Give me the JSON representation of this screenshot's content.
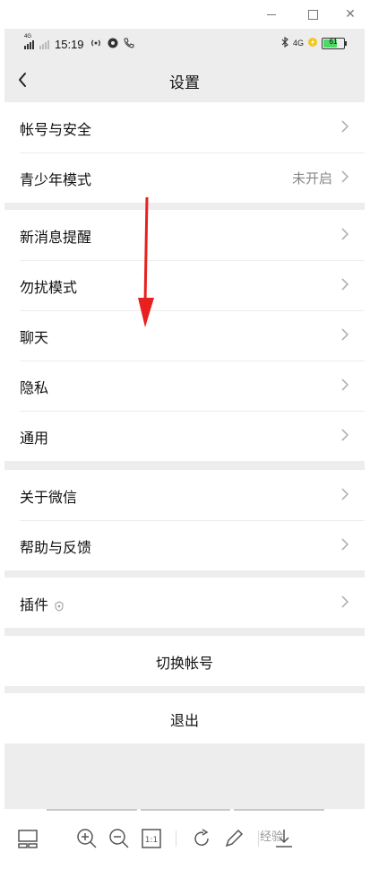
{
  "status": {
    "time": "15:19",
    "network_left": "4G",
    "network_right": "4G",
    "battery": "61"
  },
  "nav": {
    "title": "设置"
  },
  "groups": {
    "g1": [
      {
        "label": "帐号与安全",
        "value": ""
      },
      {
        "label": "青少年模式",
        "value": "未开启"
      }
    ],
    "g2": [
      {
        "label": "新消息提醒"
      },
      {
        "label": "勿扰模式"
      },
      {
        "label": "聊天"
      },
      {
        "label": "隐私"
      },
      {
        "label": "通用"
      }
    ],
    "g3": [
      {
        "label": "关于微信"
      },
      {
        "label": "帮助与反馈"
      }
    ],
    "g4": [
      {
        "label": "插件"
      }
    ]
  },
  "actions": {
    "switch_account": "切换帐号",
    "logout": "退出"
  },
  "watermark": "经验",
  "colors": {
    "background": "#ededed",
    "arrow": "#e8201f",
    "secondary_text": "#888888"
  }
}
